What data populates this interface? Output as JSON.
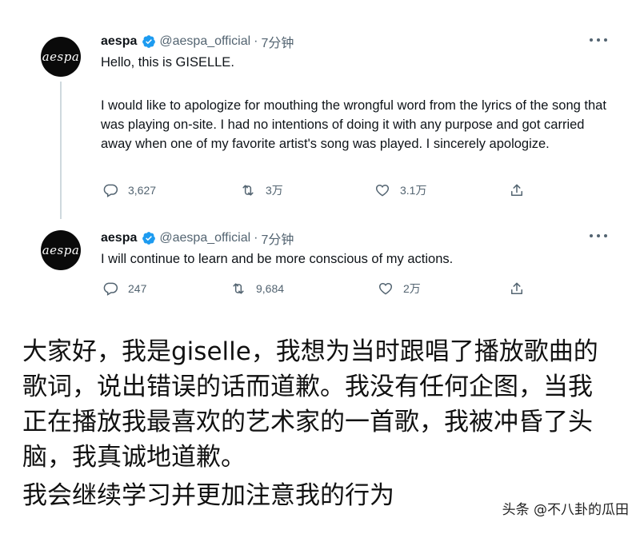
{
  "tweets": [
    {
      "avatar_text": "aespa",
      "name": "aespa",
      "handle": "@aespa_official",
      "separator": "·",
      "time": "7分钟",
      "paragraphs": [
        "Hello, this is GISELLE.",
        "I would like to apologize for mouthing the wrongful word from the lyrics of the song that was playing on-site. I had no intentions of doing it with any purpose and got carried away when one of my favorite artist's song was played. I sincerely apologize."
      ],
      "replies": "3,627",
      "retweets": "3万",
      "likes": "3.1万"
    },
    {
      "avatar_text": "aespa",
      "name": "aespa",
      "handle": "@aespa_official",
      "separator": "·",
      "time": "7分钟",
      "paragraphs": [
        "I will continue to learn and be more conscious of my actions."
      ],
      "replies": "247",
      "retweets": "9,684",
      "likes": "2万"
    }
  ],
  "translation": {
    "lines": [
      "大家好，我是giselle，我想为当时跟唱了播放歌曲的",
      "歌词，说出错误的话而道歉。我没有任何企图，当我",
      "正在播放我最喜欢的艺术家的一首歌，我被冲昏了头",
      "脑，我真诚地道歉。",
      "我会继续学习并更加注意我的行为"
    ]
  },
  "watermark": "头条 @不八卦的瓜田",
  "colors": {
    "text": "#0f1419",
    "muted": "#536471",
    "verified": "#1d9bf0",
    "thread_line": "#cfd9de"
  },
  "icons": [
    "verified-badge-icon",
    "more-options-icon",
    "reply-icon",
    "retweet-icon",
    "like-icon",
    "share-icon"
  ]
}
